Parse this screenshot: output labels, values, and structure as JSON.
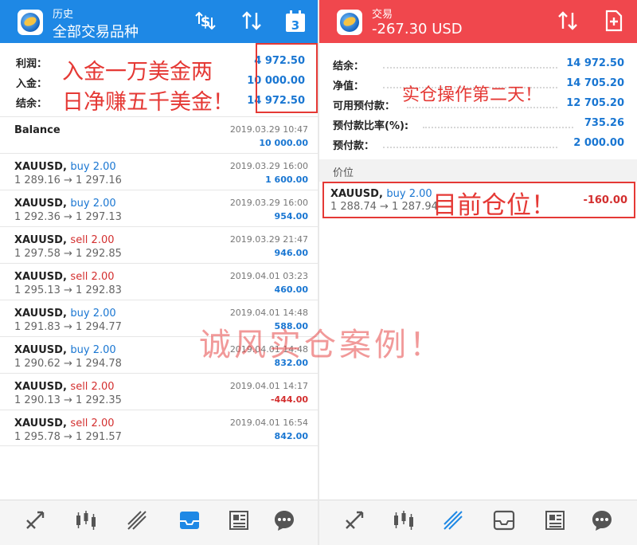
{
  "left": {
    "appbar": {
      "title": "历史",
      "subtitle": "全部交易品种",
      "icons": [
        "dollar-sort-icon",
        "sort-arrows-icon",
        "calendar-icon"
      ],
      "calendar_day": "3"
    },
    "summary": [
      {
        "label": "利润：",
        "value": "4 972.50"
      },
      {
        "label": "入金：",
        "value": "10 000.00"
      },
      {
        "label": "结余：",
        "value": "14 972.50"
      }
    ],
    "balance": {
      "label": "Balance",
      "time": "2019.03.29 10:47",
      "amount": "10 000.00"
    },
    "trades": [
      {
        "symbol": "XAUUSD,",
        "side": "buy 2.00",
        "type": "buy",
        "prices": "1 289.16 → 1 297.16",
        "time": "2019.03.29 16:00",
        "profit": "1 600.00"
      },
      {
        "symbol": "XAUUSD,",
        "side": "buy 2.00",
        "type": "buy",
        "prices": "1 292.36 → 1 297.13",
        "time": "2019.03.29 16:00",
        "profit": "954.00"
      },
      {
        "symbol": "XAUUSD,",
        "side": "sell 2.00",
        "type": "sell",
        "prices": "1 297.58 → 1 292.85",
        "time": "2019.03.29 21:47",
        "profit": "946.00"
      },
      {
        "symbol": "XAUUSD,",
        "side": "sell 2.00",
        "type": "sell",
        "prices": "1 295.13 → 1 292.83",
        "time": "2019.04.01 03:23",
        "profit": "460.00"
      },
      {
        "symbol": "XAUUSD,",
        "side": "buy 2.00",
        "type": "buy",
        "prices": "1 291.83 → 1 294.77",
        "time": "2019.04.01 14:48",
        "profit": "588.00"
      },
      {
        "symbol": "XAUUSD,",
        "side": "buy 2.00",
        "type": "buy",
        "prices": "1 290.62 → 1 294.78",
        "time": "2019.04.01 14:48",
        "profit": "832.00"
      },
      {
        "symbol": "XAUUSD,",
        "side": "sell 2.00",
        "type": "sell",
        "prices": "1 290.13 → 1 292.35",
        "time": "2019.04.01 14:17",
        "profit": "-444.00"
      },
      {
        "symbol": "XAUUSD,",
        "side": "sell 2.00",
        "type": "sell",
        "prices": "1 295.78 → 1 291.57",
        "time": "2019.04.01 16:54",
        "profit": "842.00"
      }
    ],
    "overlay_text": [
      "入金一万美金两",
      "日净赚五千美金！"
    ],
    "navbar": {
      "active": 3
    }
  },
  "right": {
    "appbar": {
      "title": "交易",
      "subtitle": "-267.30 USD",
      "icons": [
        "sort-arrows-icon",
        "new-order-icon"
      ]
    },
    "summary": [
      {
        "label": "结余：",
        "value": "14 972.50"
      },
      {
        "label": "净值：",
        "value": "14 705.20"
      },
      {
        "label": "可用预付款：",
        "value": "12 705.20"
      },
      {
        "label": "预付款比率(%):",
        "value": "735.26"
      },
      {
        "label": "预付款：",
        "value": "2 000.00"
      }
    ],
    "section_label": "价位",
    "position": {
      "symbol": "XAUUSD,",
      "side": "buy 2.00",
      "prices": "1 288.74 → 1 287.94",
      "profit": "-160.00"
    },
    "overlay_note": "实仓操作第二天！",
    "overlay_position": "目前仓位！",
    "navbar": {
      "active": 2
    }
  },
  "watermark": "诚风实仓案例！",
  "colors": {
    "left_bar": "#1e88e5",
    "right_bar": "#f0474d",
    "value_blue": "#1976d2",
    "loss_red": "#d32f2f",
    "annotation_red": "#e53935"
  }
}
